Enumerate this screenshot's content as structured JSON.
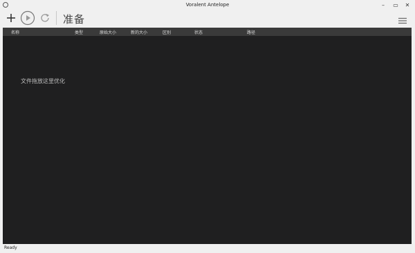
{
  "window": {
    "title": "Voralent Antelope",
    "icon": "app-icon",
    "minimize_icon": "minimize-icon",
    "maximize_icon": "maximize-icon",
    "close_icon": "close-icon"
  },
  "toolbar": {
    "add_icon": "plus-icon",
    "play_icon": "play-icon",
    "refresh_icon": "refresh-icon",
    "menu_icon": "hamburger-menu-icon",
    "status_title": "准备"
  },
  "list": {
    "columns": [
      "名称",
      "类型",
      "原始大小",
      "新的大小",
      "区别",
      "状态",
      "路径"
    ],
    "empty_hint": "文件拖放这里优化"
  },
  "statusbar": {
    "text": "Ready"
  },
  "colors": {
    "list_background": "#1f1f20",
    "header_background": "#3a3a3a",
    "chrome_background": "#f0f0f0"
  }
}
